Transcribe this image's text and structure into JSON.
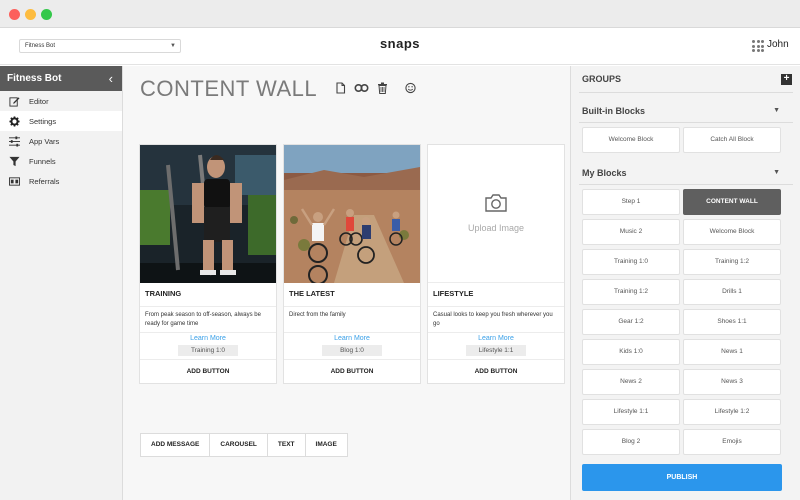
{
  "topbar": {
    "bot_select": "Fitness Bot",
    "brand": "snaps",
    "user_name": "John"
  },
  "sidebar": {
    "title": "Fitness Bot",
    "items": [
      {
        "label": "Editor",
        "icon": "edit-icon",
        "active": false
      },
      {
        "label": "Settings",
        "icon": "gear-icon",
        "active": true
      },
      {
        "label": "App Vars",
        "icon": "sliders-icon",
        "active": false
      },
      {
        "label": "Funnels",
        "icon": "funnel-icon",
        "active": false
      },
      {
        "label": "Referrals",
        "icon": "referrals-icon",
        "active": false
      }
    ]
  },
  "main": {
    "title": "CONTENT WALL",
    "title_icons": [
      "copy-icon",
      "link-icon",
      "trash-icon",
      "emoji-icon"
    ],
    "cards": [
      {
        "title": "TRAINING",
        "description": "From peak season to off-season, always be ready for game time",
        "learn_more": "Learn More",
        "tag": "Training 1:0",
        "add_button": "ADD BUTTON",
        "image": "photo-gym-ropes"
      },
      {
        "title": "THE LATEST",
        "description": "Direct from the family",
        "learn_more": "Learn More",
        "tag": "Blog 1:0",
        "add_button": "ADD BUTTON",
        "image": "photo-cyclists-desert"
      },
      {
        "title": "LIFESTYLE",
        "description": "Casual looks to keep you fresh wherever you go",
        "learn_more": "Learn More",
        "tag": "Lifestyle 1:1",
        "add_button": "ADD BUTTON",
        "upload_label": "Upload Image",
        "image": "camera-icon"
      }
    ],
    "toolbar": [
      "ADD MESSAGE",
      "CAROUSEL",
      "TEXT",
      "IMAGE"
    ]
  },
  "right_panel": {
    "groups_title": "GROUPS",
    "builtin_title": "Built-in Blocks",
    "builtin_blocks": [
      "Welcome Block",
      "Catch All Block"
    ],
    "my_blocks_title": "My Blocks",
    "my_blocks": [
      "Step 1",
      "CONTENT WALL",
      "Music 2",
      "Welcome Block",
      "Training 1:0",
      "Training 1:2",
      "Training 1:2",
      "Drills 1",
      "Gear 1:2",
      "Shoes 1:1",
      "Kids 1:0",
      "News 1",
      "News 2",
      "News 3",
      "Lifestyle 1:1",
      "Lifestyle 1:2",
      "Blog 2",
      "Emojis"
    ],
    "selected_block": "CONTENT WALL",
    "publish_label": "PUBLISH"
  },
  "colors": {
    "accent": "#2b96ec",
    "link": "#3aa0e8",
    "sidebar_header": "#5a5a5a",
    "selected_block": "#5f5f5f"
  }
}
